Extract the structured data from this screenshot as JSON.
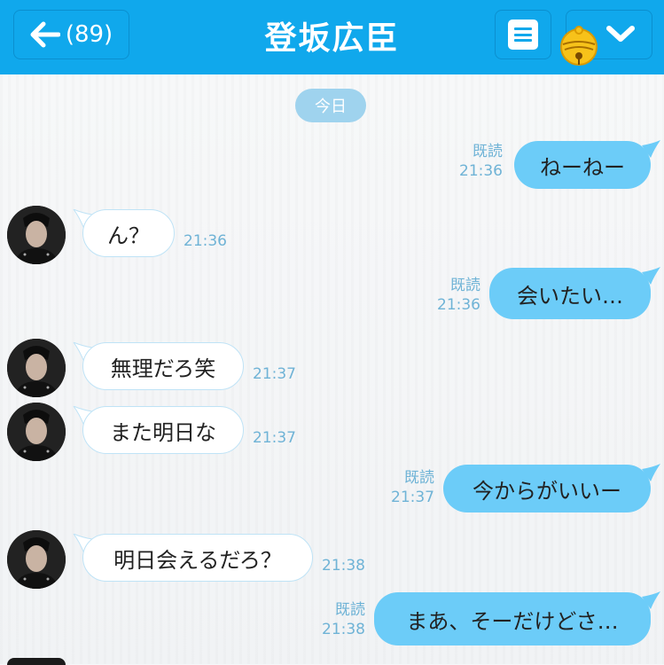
{
  "header": {
    "back_label": "(89)",
    "title": "登坂広臣"
  },
  "chat": {
    "date_label": "今日",
    "read_label": "既読",
    "messages": [
      {
        "side": "out",
        "text": "ねーねー",
        "time": "21:36",
        "read": "既読"
      },
      {
        "side": "in",
        "text": "ん？",
        "time": "21:36"
      },
      {
        "side": "out",
        "text": "会いたい…",
        "time": "21:36",
        "read": "既読"
      },
      {
        "side": "in",
        "text": "無理だろ笑",
        "time": "21:37"
      },
      {
        "side": "in",
        "text": "また明日な",
        "time": "21:37"
      },
      {
        "side": "out",
        "text": "今からがいいー",
        "time": "21:37",
        "read": "既読"
      },
      {
        "side": "in",
        "text": "明日会えるだろ？",
        "time": "21:38"
      },
      {
        "side": "out",
        "text": "まあ、そーだけどさ…",
        "time": "21:38",
        "read": "既読"
      }
    ]
  },
  "colors": {
    "header_bg": "#10a8ec",
    "outgoing_bubble": "#6cccf8",
    "incoming_bubble": "#ffffff",
    "meta_text": "#6fb3d6"
  },
  "icons": [
    "back-arrow-icon",
    "menu-icon",
    "chevron-down-icon",
    "bell-icon",
    "avatar"
  ]
}
